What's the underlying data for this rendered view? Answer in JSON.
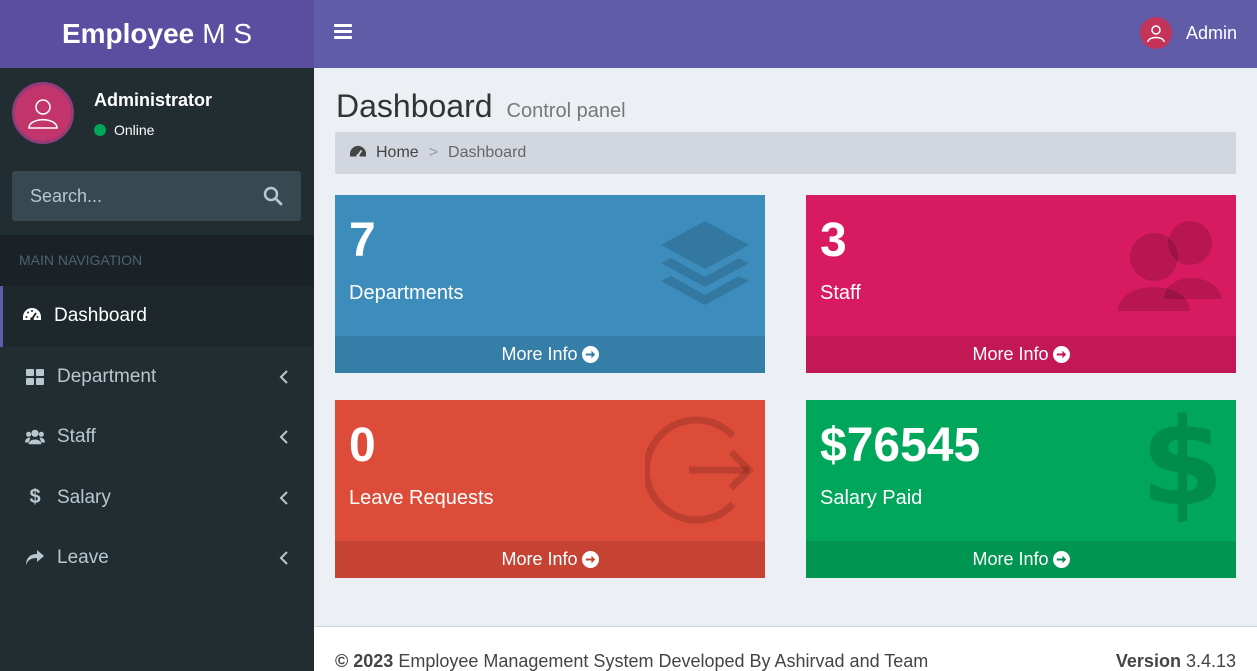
{
  "header": {
    "logo_bold": "Employee",
    "logo_rest": "M S",
    "user_name": "Admin"
  },
  "sidebar": {
    "user": {
      "name": "Administrator",
      "status": "Online"
    },
    "search": {
      "placeholder": "Search..."
    },
    "nav_header": "MAIN NAVIGATION",
    "items": [
      {
        "label": "Dashboard",
        "icon": "dashboard-icon",
        "active": true
      },
      {
        "label": "Department",
        "icon": "grid-icon"
      },
      {
        "label": "Staff",
        "icon": "users-icon"
      },
      {
        "label": "Salary",
        "icon": "dollar-icon"
      },
      {
        "label": "Leave",
        "icon": "share-icon"
      }
    ]
  },
  "content": {
    "title": "Dashboard",
    "subtitle": "Control panel",
    "breadcrumb": {
      "home": "Home",
      "separator": ">",
      "current": "Dashboard"
    }
  },
  "boxes": [
    {
      "value": "7",
      "label": "Departments",
      "footer": "More Info",
      "color": "#3c8dbc",
      "icon": "layers-icon"
    },
    {
      "value": "3",
      "label": "Staff",
      "footer": "More Info",
      "color": "#d81b60",
      "icon": "users-icon"
    },
    {
      "value": "0",
      "label": "Leave Requests",
      "footer": "More Info",
      "color": "#dd4b39",
      "icon": "sign-out-icon"
    },
    {
      "value": "$76545",
      "label": "Salary Paid",
      "footer": "More Info",
      "color": "#00a65a",
      "icon": "dollar-icon"
    }
  ],
  "footer": {
    "copyright_bold": "© 2023",
    "copyright_text": "Employee Management System Developed By Ashirvad and Team",
    "version_label": "Version",
    "version_number": "3.4.13"
  },
  "colors": {
    "header": "#605ca8",
    "logo": "#5b4ea1",
    "sidebar": "#222d32",
    "content_bg": "#ecf0f5"
  }
}
